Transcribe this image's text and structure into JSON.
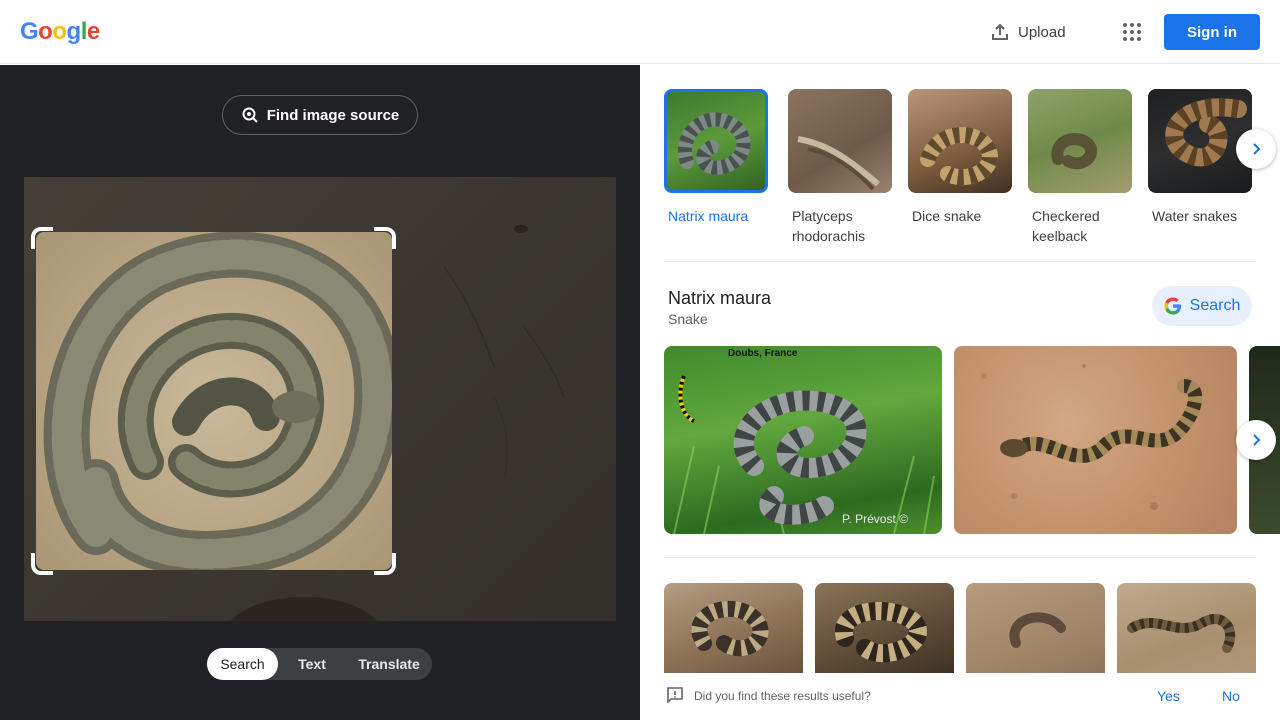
{
  "header": {
    "logo_letters": [
      "G",
      "o",
      "o",
      "g",
      "l",
      "e"
    ],
    "logo_colors": [
      "#4285F4",
      "#EA4335",
      "#FBBC05",
      "#4285F4",
      "#34A853",
      "#EA4335"
    ],
    "upload_label": "Upload",
    "signin_label": "Sign in",
    "icons": [
      "upload-icon",
      "apps-grid-icon"
    ]
  },
  "lens": {
    "find_source_label": "Find image source",
    "find_source_icon": "lens-search-icon",
    "modes": [
      {
        "label": "Search",
        "active": true
      },
      {
        "label": "Text",
        "active": false
      },
      {
        "label": "Translate",
        "active": false
      }
    ]
  },
  "results": {
    "chips": [
      {
        "label": "Natrix maura",
        "selected": true
      },
      {
        "label": "Platyceps rhodorachis",
        "selected": false
      },
      {
        "label": "Dice snake",
        "selected": false
      },
      {
        "label": "Checkered keelback",
        "selected": false
      },
      {
        "label": "Water snakes",
        "selected": false
      }
    ],
    "entity": {
      "title": "Natrix maura",
      "subtitle": "Snake",
      "search_label": "Search"
    },
    "big_images": [
      {
        "watermark_top": "Doubs, France",
        "watermark_bottom": "P. Prévost ©"
      },
      {},
      {}
    ],
    "grid_image_count": 4
  },
  "feedback": {
    "question": "Did you find these results useful?",
    "yes": "Yes",
    "no": "No"
  },
  "colors": {
    "accent": "#1a73e8",
    "dark_panel": "#202124"
  }
}
